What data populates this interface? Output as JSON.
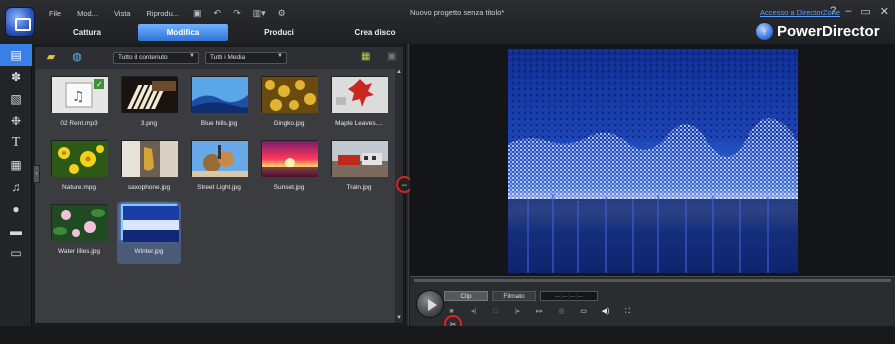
{
  "window": {
    "project_title": "Nuovo progetto senza titolo*",
    "directorzone_link": "Accesso a DirectorZone",
    "controls": [
      "?",
      "–",
      "▭",
      "✕"
    ]
  },
  "menu": [
    "File",
    "Mod...",
    "Vista",
    "Riprodu..."
  ],
  "toolbar_icons": [
    "save-icon",
    "undo-icon",
    "redo-icon",
    "layout-icon",
    "settings-icon"
  ],
  "mode_tabs": [
    {
      "label": "Cattura",
      "active": false
    },
    {
      "label": "Modifica",
      "active": true
    },
    {
      "label": "Produci",
      "active": false
    },
    {
      "label": "Crea disco",
      "active": false
    }
  ],
  "brand": {
    "name": "PowerDirector",
    "icon_glyph": "↑"
  },
  "left_rail": [
    {
      "icon": "media-room-icon",
      "active": true
    },
    {
      "icon": "effects-icon",
      "active": false
    },
    {
      "icon": "pip-icon",
      "active": false
    },
    {
      "icon": "particle-icon",
      "active": false
    },
    {
      "icon": "title-icon",
      "active": false
    },
    {
      "icon": "transition-icon",
      "active": false
    },
    {
      "icon": "audio-mixing-icon",
      "active": false
    },
    {
      "icon": "voice-over-icon",
      "active": false
    },
    {
      "icon": "chapter-icon",
      "active": false
    },
    {
      "icon": "subtitle-icon",
      "active": false
    }
  ],
  "library": {
    "filter_content": "Tutto il contenuto",
    "filter_media": "Tutti i Media",
    "items": [
      {
        "label": "02 Rent.mp3",
        "kind": "audio",
        "selected": false
      },
      {
        "label": "3.png",
        "kind": "piano",
        "selected": false
      },
      {
        "label": "Blue hills.jpg",
        "kind": "hills",
        "selected": false
      },
      {
        "label": "Gingko.jpg",
        "kind": "gingko",
        "selected": false
      },
      {
        "label": "Maple Leaves....",
        "kind": "maple",
        "selected": false
      },
      {
        "label": "Nature.mpg",
        "kind": "nature",
        "selected": false
      },
      {
        "label": "saxophone.jpg",
        "kind": "sax",
        "selected": false
      },
      {
        "label": "Street Light.jpg",
        "kind": "street",
        "selected": false
      },
      {
        "label": "Sunset.jpg",
        "kind": "sunset",
        "selected": false
      },
      {
        "label": "Train.jpg",
        "kind": "train",
        "selected": false
      },
      {
        "label": "Water lilies.jpg",
        "kind": "lilies",
        "selected": false
      },
      {
        "label": "Winter.jpg",
        "kind": "winter",
        "selected": true
      }
    ]
  },
  "player": {
    "clip_label": "Clip",
    "film_label": "Filmato",
    "timecode": "--:--:--:--",
    "controls": [
      "stop-icon",
      "prev-frame-icon",
      "next-icon",
      "fast-forward-icon",
      "end-icon",
      "snapshot-icon",
      "display-icon",
      "volume-icon",
      "fullscreen-icon"
    ]
  },
  "colors": {
    "accent": "#3a7fe6",
    "highlight_ring": "#dd2222",
    "link": "#5aa0ff"
  }
}
